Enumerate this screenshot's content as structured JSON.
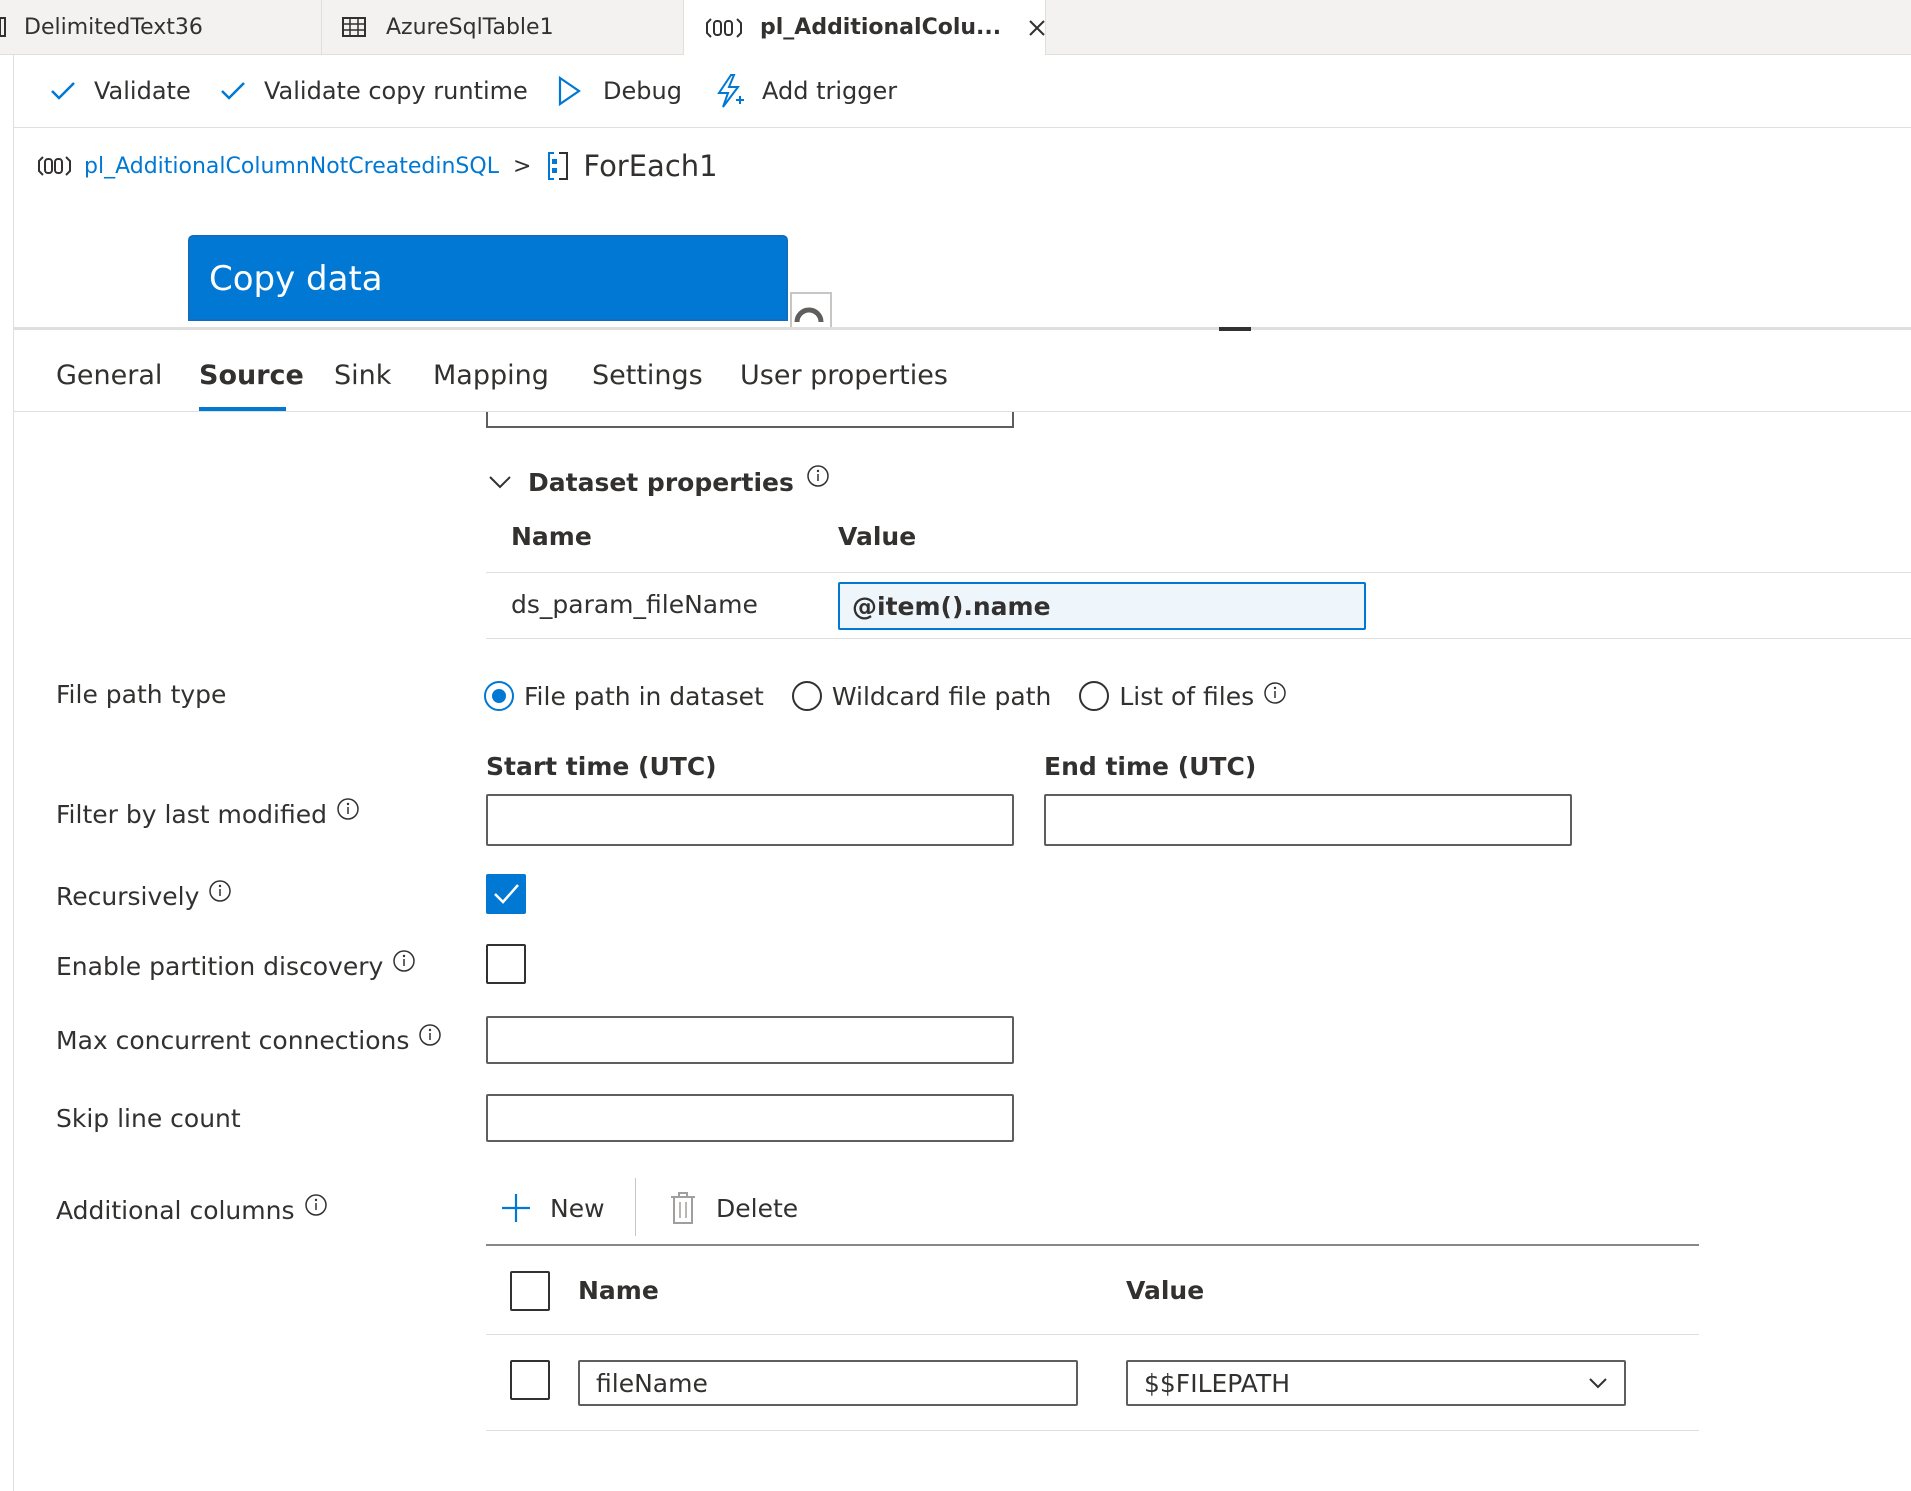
{
  "tabs": [
    {
      "label": "DelimitedText36",
      "icon": "dataset-icon"
    },
    {
      "label": "AzureSqlTable1",
      "icon": "table-icon"
    },
    {
      "label": "pl_AdditionalColu...",
      "icon": "pipeline-icon",
      "active": true
    }
  ],
  "toolbar": {
    "validate": "Validate",
    "validate_copy_runtime": "Validate copy runtime",
    "debug": "Debug",
    "add_trigger": "Add trigger"
  },
  "breadcrumb": {
    "pipeline": "pl_AdditionalColumnNotCreatedinSQL",
    "separator": ">",
    "current": "ForEach1"
  },
  "canvas": {
    "activity_title": "Copy data"
  },
  "property_tabs": [
    "General",
    "Source",
    "Sink",
    "Mapping",
    "Settings",
    "User properties"
  ],
  "dataset_properties": {
    "title": "Dataset properties",
    "col_name": "Name",
    "col_value": "Value",
    "rows": [
      {
        "name": "ds_param_fileName",
        "value": "@item().name"
      }
    ]
  },
  "file_path_type": {
    "label": "File path type",
    "options": [
      "File path in dataset",
      "Wildcard file path",
      "List of files"
    ],
    "selected": "File path in dataset"
  },
  "filter_last_modified": {
    "label": "Filter by last modified",
    "start_label": "Start time (UTC)",
    "end_label": "End time (UTC)",
    "start_value": "",
    "end_value": ""
  },
  "recursively": {
    "label": "Recursively",
    "checked": true
  },
  "partition_discovery": {
    "label": "Enable partition discovery",
    "checked": false
  },
  "max_connections": {
    "label": "Max concurrent connections",
    "value": ""
  },
  "skip_line_count": {
    "label": "Skip line count",
    "value": ""
  },
  "additional_columns": {
    "label": "Additional columns",
    "new_label": "New",
    "delete_label": "Delete",
    "col_name": "Name",
    "col_value": "Value",
    "rows": [
      {
        "name": "fileName",
        "value": "$$FILEPATH",
        "checked": false
      }
    ]
  },
  "colors": {
    "accent": "#0078d4",
    "text": "#323130",
    "border": "#e1dfdd"
  }
}
